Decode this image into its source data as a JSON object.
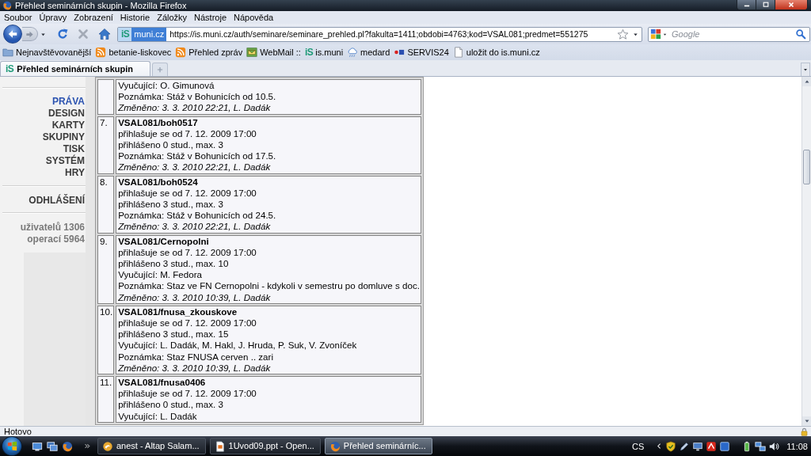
{
  "window": {
    "title": "Přehled seminárních skupin - Mozilla Firefox"
  },
  "menu": [
    "Soubor",
    "Úpravy",
    "Zobrazení",
    "Historie",
    "Záložky",
    "Nástroje",
    "Nápověda"
  ],
  "toolbar": {
    "nav": [
      {
        "kind": "back",
        "disabled": false
      },
      {
        "kind": "forward",
        "disabled": true
      },
      {
        "kind": "history",
        "disabled": false
      },
      {
        "kind": "reload",
        "disabled": false
      },
      {
        "kind": "stop",
        "disabled": true
      },
      {
        "kind": "home",
        "disabled": false
      }
    ],
    "address": {
      "logo": "iS",
      "identity": "muni.cz",
      "url": "https://is.muni.cz/auth/seminare/seminare_prehled.pl?fakulta=1411;obdobi=4763;kod=VSAL081;predmet=551275"
    },
    "search": {
      "placeholder": "Google"
    }
  },
  "bookmarks": [
    {
      "kind": "frequent",
      "label": "Nejnavštěvovanější"
    },
    {
      "kind": "feed",
      "label": "betanie-liskovec"
    },
    {
      "kind": "feed",
      "label": "Přehled zpráv"
    },
    {
      "kind": "webmail",
      "label": "WebMail ::"
    },
    {
      "kind": "logo",
      "logo": "iS",
      "label": "is.muni"
    },
    {
      "kind": "weather",
      "label": "medard"
    },
    {
      "kind": "servis",
      "label": "SERVIS24"
    },
    {
      "kind": "page",
      "label": "uložit do is.muni.cz"
    }
  ],
  "tabs": [
    {
      "logo": "iS",
      "label": "Přehled seminárních skupin",
      "selected": true
    }
  ],
  "sidebar": {
    "menu": [
      {
        "label": "PRÁVA",
        "selected": true
      },
      {
        "label": "DESIGN",
        "selected": false
      },
      {
        "label": "KARTY",
        "selected": false
      },
      {
        "label": "SKUPINY",
        "selected": false
      },
      {
        "label": "TISK",
        "selected": false
      },
      {
        "label": "SYSTÉM",
        "selected": false
      },
      {
        "label": "HRY",
        "selected": false
      }
    ],
    "logout": "ODHLÁŠENÍ",
    "stats": [
      "uživatelů 1306",
      "operací 5964"
    ]
  },
  "groups": [
    {
      "details": [
        "Vyučující: O. Gimunová",
        "Poznámka: Stáž v Bohunicích od 10.5."
      ],
      "changed": "Změněno: 3. 3. 2010 22:21, L. Dadák"
    },
    {
      "number": "7.",
      "code": "VSAL081/boh0517",
      "details": [
        "přihlašuje se od 7. 12. 2009 17:00",
        "přihlášeno 0 stud., max. 3",
        "Poznámka: Stáž v Bohunicích od 17.5."
      ],
      "changed": "Změněno: 3. 3. 2010 22:21, L. Dadák"
    },
    {
      "number": "8.",
      "code": "VSAL081/boh0524",
      "details": [
        "přihlašuje se od 7. 12. 2009 17:00",
        "přihlášeno 3 stud., max. 3",
        "Poznámka: Stáž v Bohunicích od 24.5."
      ],
      "changed": "Změněno: 3. 3. 2010 22:21, L. Dadák"
    },
    {
      "number": "9.",
      "code": "VSAL081/Cernopolni",
      "details": [
        "přihlašuje se od 7. 12. 2009 17:00",
        "přihlášeno 3 stud., max. 10",
        "Vyučující: M. Fedora",
        "Poznámka: Staz ve FN Cernopolni - kdykoli v semestru po domluve s doc."
      ],
      "changed": "Změněno: 3. 3. 2010 10:39, L. Dadák"
    },
    {
      "number": "10.",
      "code": "VSAL081/fnusa_zkouskove",
      "details": [
        "přihlašuje se od 7. 12. 2009 17:00",
        "přihlášeno 3 stud., max. 15",
        "Vyučující: L. Dadák, M. Hakl, J. Hruda, P. Suk, V. Zvoníček",
        "Poznámka: Staz FNUSA cerven .. zari"
      ],
      "changed": "Změněno: 3. 3. 2010 10:39, L. Dadák"
    },
    {
      "number": "11.",
      "code": "VSAL081/fnusa0406",
      "details": [
        "přihlašuje se od 7. 12. 2009 17:00",
        "přihlášeno 0 stud., max. 3",
        "Vyučující: L. Dadák"
      ]
    }
  ],
  "status_bar": {
    "text": "Hotovo"
  },
  "taskbar": {
    "tasks": [
      {
        "kind": "filemanager",
        "label": "anest - Altap Salam...",
        "selected": false
      },
      {
        "kind": "presentation",
        "label": "1Uvod09.ppt - Open...",
        "selected": false
      },
      {
        "kind": "browser",
        "label": "Přehled seminárníc...",
        "selected": true
      }
    ],
    "language": "CS",
    "clock": "11:08"
  }
}
